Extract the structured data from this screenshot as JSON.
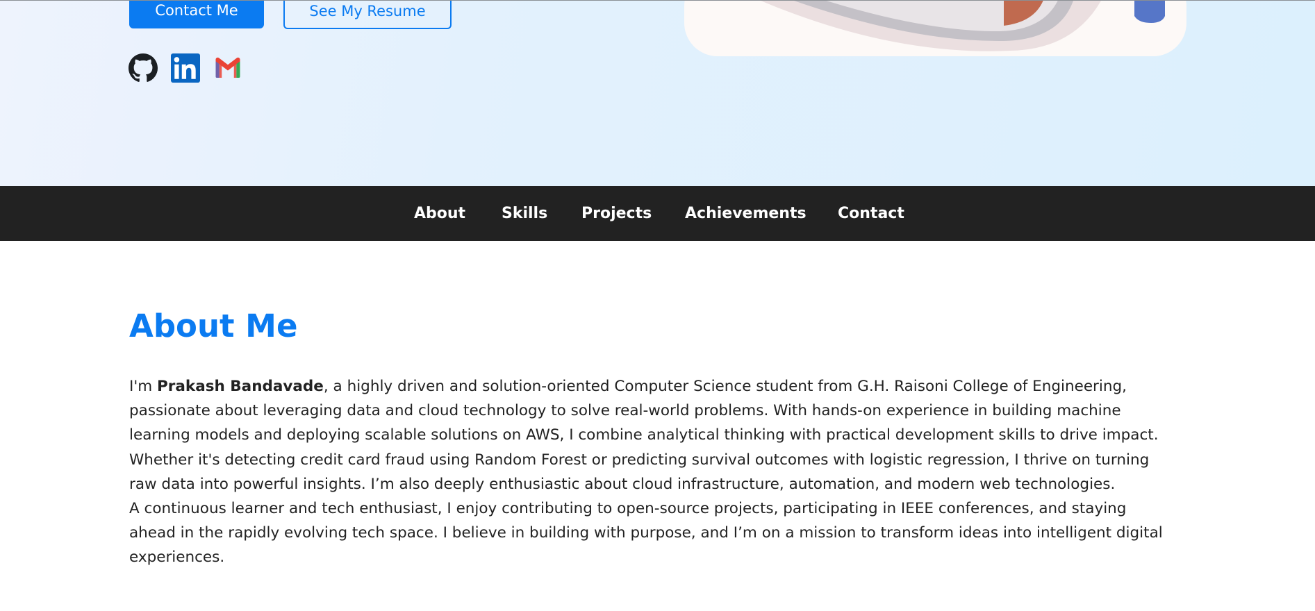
{
  "hero": {
    "contact_button": "Contact Me",
    "resume_button": "See My Resume",
    "social_icons": [
      "github-icon",
      "linkedin-icon",
      "gmail-icon"
    ]
  },
  "nav": {
    "items": [
      "About",
      "Skills",
      "Projects",
      "Achievements",
      "Contact"
    ]
  },
  "about": {
    "title": "About Me",
    "name": "Prakash Bandavade",
    "lines": [
      {
        "pre": "I'm ",
        "post": ", a highly driven and solution-oriented Computer Science student from G.H. Raisoni College of Engineering,"
      },
      "passionate about leveraging data and cloud technology to solve real-world problems. With hands-on experience in building machine",
      "learning models and deploying scalable solutions on AWS, I combine analytical thinking with practical development skills to drive impact.",
      "Whether it's detecting credit card fraud using Random Forest or predicting survival outcomes with logistic regression, I thrive on turning",
      "raw data into powerful insights. I’m also deeply enthusiastic about cloud infrastructure, automation, and modern web technologies.",
      "A continuous learner and tech enthusiast, I enjoy contributing to open-source projects, participating in IEEE conferences, and staying",
      "ahead in the rapidly evolving tech space. I believe in building with purpose, and I’m on a mission to transform ideas into intelligent digital",
      "experiences."
    ]
  },
  "colors": {
    "accent": "#0b7bf1",
    "navbar_bg": "#222222",
    "text": "#222222"
  }
}
